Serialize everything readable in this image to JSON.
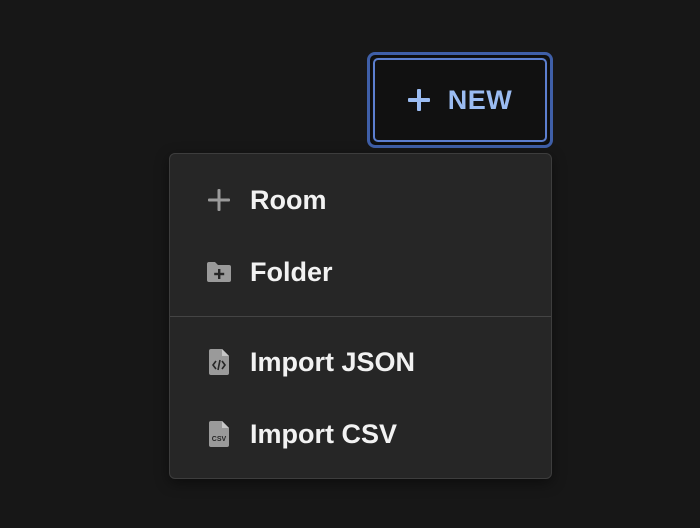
{
  "new_button": {
    "label": "NEW",
    "icon": "plus-icon",
    "accent_color": "#9bbcf2",
    "focus_ring_color": "#5c7fd0"
  },
  "menu": {
    "items": [
      {
        "label": "Room",
        "icon": "plus-icon"
      },
      {
        "label": "Folder",
        "icon": "folder-plus-icon"
      },
      {
        "label": "Import JSON",
        "icon": "file-code-icon"
      },
      {
        "label": "Import CSV",
        "icon": "file-csv-icon",
        "icon_text": "CSV"
      }
    ]
  }
}
